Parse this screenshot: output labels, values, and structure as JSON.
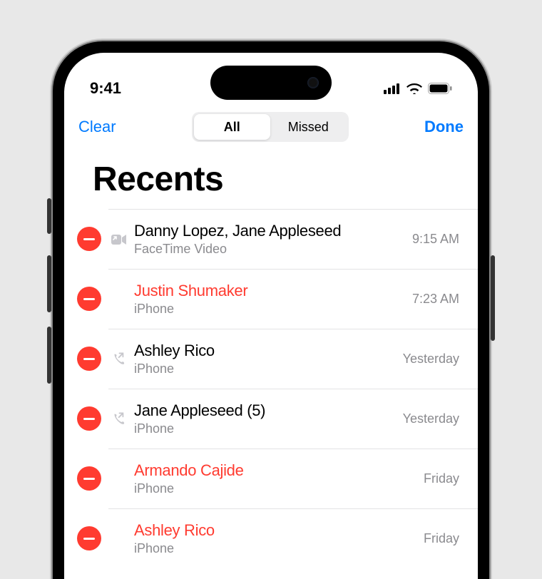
{
  "status": {
    "time": "9:41"
  },
  "nav": {
    "left": "Clear",
    "right": "Done",
    "seg_all": "All",
    "seg_missed": "Missed"
  },
  "header": {
    "title": "Recents"
  },
  "calls": [
    {
      "name": "Danny Lopez, Jane Appleseed",
      "sub": "FaceTime Video",
      "time": "9:15 AM",
      "missed": false,
      "icon": "video"
    },
    {
      "name": "Justin Shumaker",
      "sub": "iPhone",
      "time": "7:23 AM",
      "missed": true,
      "icon": "none"
    },
    {
      "name": "Ashley Rico",
      "sub": "iPhone",
      "time": "Yesterday",
      "missed": false,
      "icon": "outgoing"
    },
    {
      "name": "Jane Appleseed (5)",
      "sub": "iPhone",
      "time": "Yesterday",
      "missed": false,
      "icon": "outgoing"
    },
    {
      "name": "Armando Cajide",
      "sub": "iPhone",
      "time": "Friday",
      "missed": true,
      "icon": "none"
    },
    {
      "name": "Ashley Rico",
      "sub": "iPhone",
      "time": "Friday",
      "missed": true,
      "icon": "none"
    }
  ]
}
